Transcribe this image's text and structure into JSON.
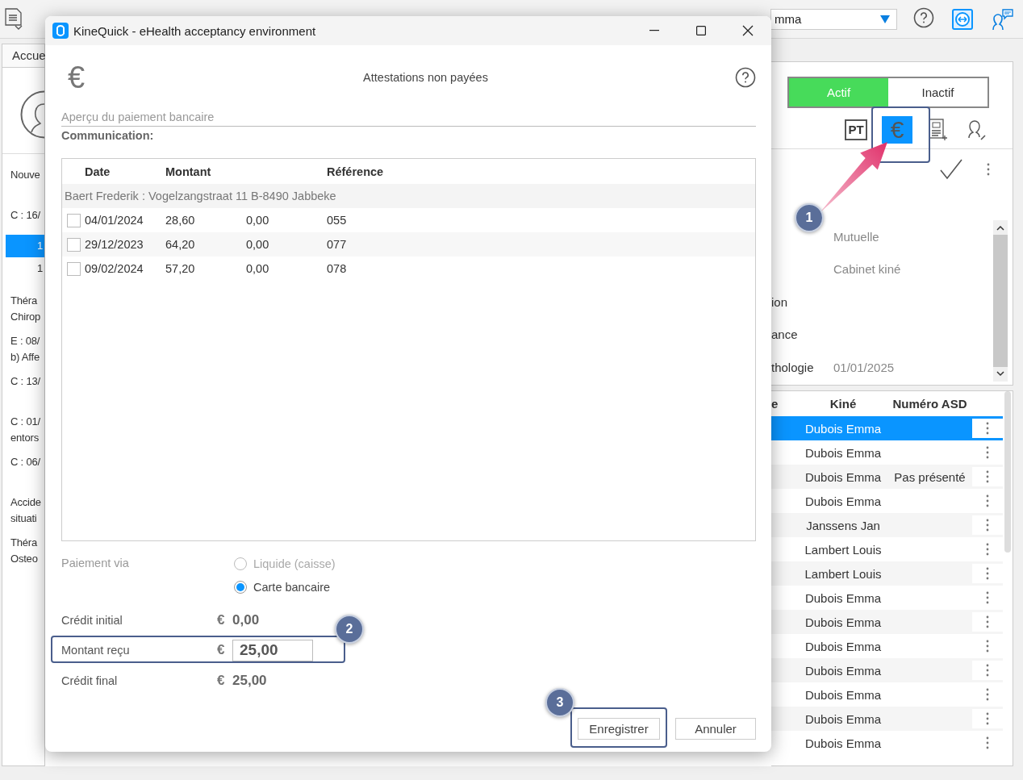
{
  "toolbar": {
    "user_dropdown": {
      "value": "mma"
    }
  },
  "left_pane": {
    "tab": "Accue",
    "items": [
      {
        "kind": "entry",
        "lines": [
          "Nouve"
        ],
        "selected": false
      },
      {
        "kind": "entry",
        "lines": [
          "C : 16/"
        ],
        "selected": false
      },
      {
        "kind": "number",
        "lines": [
          "1"
        ],
        "selected": true
      },
      {
        "kind": "number",
        "lines": [
          "1"
        ],
        "selected": false
      },
      {
        "kind": "entry",
        "lines": [
          "Théra",
          "Chirop"
        ],
        "selected": false
      },
      {
        "kind": "entry",
        "lines": [
          "E : 08/",
          "b) Affe"
        ],
        "selected": false
      },
      {
        "kind": "entry",
        "lines": [
          "C : 13/"
        ],
        "selected": false
      },
      {
        "kind": "entry",
        "lines": [
          "C : 01/",
          "entors"
        ],
        "selected": false
      },
      {
        "kind": "entry",
        "lines": [
          "C : 06/"
        ],
        "selected": false
      },
      {
        "kind": "entry",
        "lines": [
          "Accide",
          "situati"
        ],
        "selected": false
      },
      {
        "kind": "entry",
        "lines": [
          "Théra",
          "Osteo"
        ],
        "selected": false
      }
    ]
  },
  "right_pane": {
    "status_toggle": [
      {
        "label": "Actif",
        "selected": true
      },
      {
        "label": "Inactif",
        "selected": false
      }
    ],
    "icon_tabs": [
      {
        "kind": "pt",
        "label": "PT",
        "selected": false
      },
      {
        "kind": "euro",
        "label": "€",
        "selected": true
      },
      {
        "kind": "document",
        "selected": false
      },
      {
        "kind": "person",
        "selected": false
      }
    ],
    "form": [
      {
        "placeholder": "Mutuelle"
      },
      {
        "placeholder": "Cabinet kiné"
      },
      {
        "label": "ion"
      },
      {
        "label": "ance"
      },
      {
        "label": "thologie",
        "placeholder": "01/01/2025"
      }
    ],
    "table": {
      "columns": [
        "e",
        "Kiné",
        "Numéro ASD"
      ],
      "rows": [
        {
          "kine": "Dubois Emma",
          "selected": true
        },
        {
          "kine": "Dubois Emma",
          "selected": false
        },
        {
          "kine": "Dubois Emma",
          "asd": "Pas présenté",
          "selected": false
        },
        {
          "kine": "Dubois Emma",
          "selected": false
        },
        {
          "kine": "Janssens Jan",
          "selected": false
        },
        {
          "kine": "Lambert Louis",
          "selected": false
        },
        {
          "kine": "Lambert Louis",
          "selected": false
        },
        {
          "kine": "Dubois Emma",
          "selected": false
        },
        {
          "kine": "Dubois Emma",
          "selected": false
        },
        {
          "kine": "Dubois Emma",
          "selected": false
        },
        {
          "kine": "Dubois Emma",
          "selected": false
        },
        {
          "kine": "Dubois Emma",
          "selected": false
        },
        {
          "kine": "Dubois Emma",
          "selected": false
        },
        {
          "kine": "Dubois Emma",
          "selected": false
        }
      ]
    }
  },
  "dialog": {
    "title": "KineQuick - eHealth acceptancy environment",
    "header_glyph": "€",
    "heading": "Attestations non payées",
    "section": "Aperçu du paiement bancaire",
    "communication": "Communication:",
    "table": {
      "columns": [
        "Date",
        "Montant",
        "Référence"
      ],
      "group": "Baert Frederik : Vogelzangstraat 11 B-8490 Jabbeke",
      "rows": [
        {
          "checked": false,
          "date": "04/01/2024",
          "montant": "28,60",
          "column_3": "0,00",
          "reference": "055"
        },
        {
          "checked": false,
          "date": "29/12/2023",
          "montant": "64,20",
          "column_3": "0,00",
          "reference": "077"
        },
        {
          "checked": false,
          "date": "09/02/2024",
          "montant": "57,20",
          "column_3": "0,00",
          "reference": "078"
        }
      ]
    },
    "payment": {
      "label": "Paiement via",
      "options": [
        {
          "label": "Liquide (caisse)",
          "selected": false,
          "disabled": true
        },
        {
          "label": "Carte bancaire",
          "selected": true,
          "disabled": false
        }
      ]
    },
    "credits": [
      {
        "kind": "text",
        "label": "Crédit initial",
        "currency": "€",
        "value": "0,00"
      },
      {
        "kind": "input",
        "label": "Montant reçu",
        "currency": "€",
        "value": "25,00"
      },
      {
        "kind": "text",
        "label": "Crédit final",
        "currency": "€",
        "value": "25,00"
      }
    ],
    "buttons": [
      "Enregistrer",
      "Annuler"
    ]
  },
  "annotations": [
    {
      "number": "1"
    },
    {
      "number": "2"
    },
    {
      "number": "3"
    }
  ]
}
